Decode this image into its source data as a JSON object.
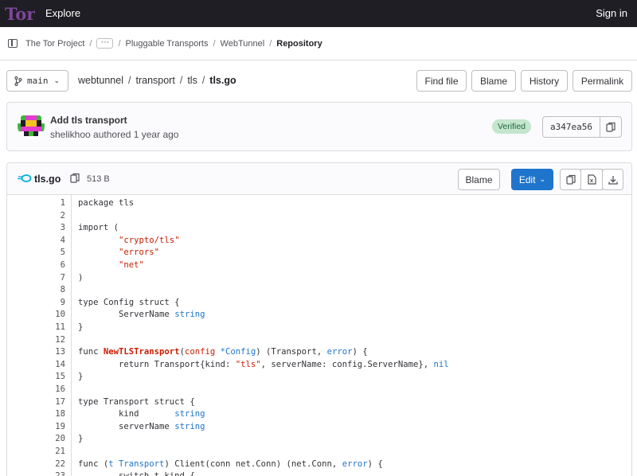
{
  "topbar": {
    "logo": "Tor",
    "explore": "Explore",
    "signin": "Sign in"
  },
  "breadcrumb": {
    "items": [
      "The Tor Project",
      "Pluggable Transports",
      "WebTunnel"
    ],
    "more": "···",
    "current": "Repository"
  },
  "branch": {
    "name": "main"
  },
  "path": {
    "segments": [
      "webtunnel",
      "transport",
      "tls"
    ],
    "file": "tls.go"
  },
  "actions": {
    "find_file": "Find file",
    "blame": "Blame",
    "history": "History",
    "permalink": "Permalink"
  },
  "commit": {
    "title": "Add tls transport",
    "author": "shelikhoo",
    "meta": "authored 1 year ago",
    "verified": "Verified",
    "sha": "a347ea56"
  },
  "file": {
    "name": "tls.go",
    "size": "513 B",
    "blame": "Blame",
    "edit": "Edit"
  },
  "code_lines": [
    "package tls",
    "",
    "import (",
    "\t\"crypto/tls\"",
    "\t\"errors\"",
    "\t\"net\"",
    ")",
    "",
    "type Config struct {",
    "\tServerName string",
    "}",
    "",
    "func NewTLSTransport(config *Config) (Transport, error) {",
    "\treturn Transport{kind: \"tls\", serverName: config.ServerName}, nil",
    "}",
    "",
    "type Transport struct {",
    "\tkind       string",
    "\tserverName string",
    "}",
    "",
    "func (t Transport) Client(conn net.Conn) (net.Conn, error) {",
    "\tswitch t.kind {"
  ],
  "colors": {
    "topbar": "#1f1e24",
    "accent": "#1f75cb",
    "verified_bg": "#c3e6cd",
    "verified_text": "#24663b",
    "string": "#c91c00"
  }
}
